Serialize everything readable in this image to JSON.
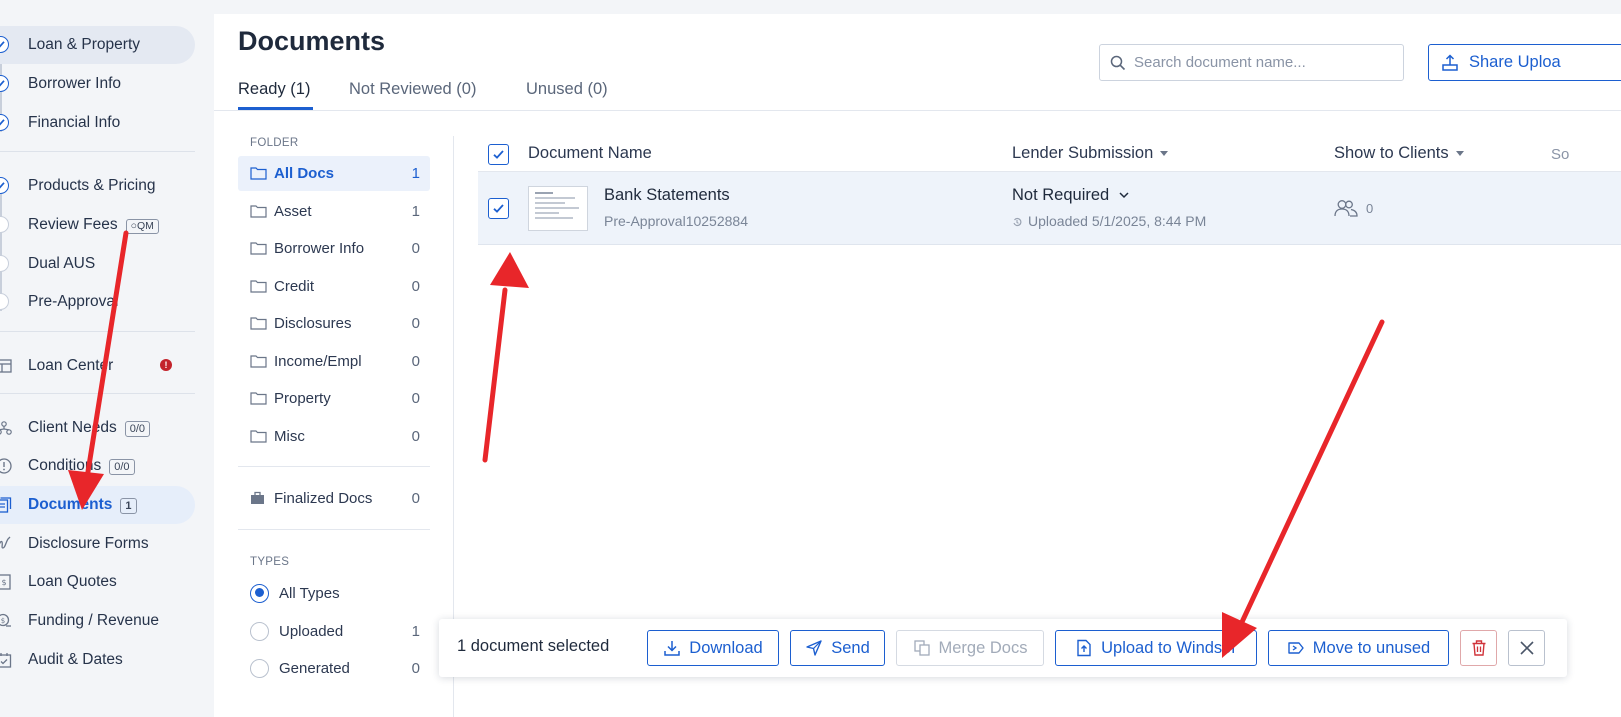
{
  "sidebar": {
    "items": [
      {
        "label": "Loan & Property",
        "state": "done",
        "active": true
      },
      {
        "label": "Borrower Info",
        "state": "done"
      },
      {
        "label": "Financial Info",
        "state": "done"
      },
      {
        "label": "Products & Pricing",
        "state": "done"
      },
      {
        "label": "Review Fees",
        "state": "todo",
        "tag": "QM"
      },
      {
        "label": "Dual AUS",
        "state": "todo"
      },
      {
        "label": "Pre-Approval",
        "state": "todo"
      },
      {
        "label": "Loan Center",
        "alert": "!"
      },
      {
        "label": "Client Needs",
        "badge": "0/0"
      },
      {
        "label": "Conditions",
        "badge": "0/0"
      },
      {
        "label": "Documents",
        "badge": "1",
        "selected": true
      },
      {
        "label": "Disclosure Forms"
      },
      {
        "label": "Loan Quotes"
      },
      {
        "label": "Funding / Revenue"
      },
      {
        "label": "Audit & Dates"
      }
    ]
  },
  "header": {
    "title": "Documents",
    "search_placeholder": "Search document name...",
    "share_label": "Share Uploa"
  },
  "tabs": [
    {
      "label": "Ready (1)",
      "active": true
    },
    {
      "label": "Not Reviewed (0)"
    },
    {
      "label": "Unused (0)"
    }
  ],
  "folders": {
    "section_label": "FOLDER",
    "items": [
      {
        "name": "All Docs",
        "count": "1",
        "selected": true
      },
      {
        "name": "Asset",
        "count": "1"
      },
      {
        "name": "Borrower Info",
        "count": "0"
      },
      {
        "name": "Credit",
        "count": "0"
      },
      {
        "name": "Disclosures",
        "count": "0"
      },
      {
        "name": "Income/Empl",
        "count": "0"
      },
      {
        "name": "Property",
        "count": "0"
      },
      {
        "name": "Misc",
        "count": "0"
      }
    ],
    "finalized": {
      "name": "Finalized Docs",
      "count": "0"
    }
  },
  "types": {
    "section_label": "TYPES",
    "items": [
      {
        "name": "All Types",
        "count": "",
        "selected": true
      },
      {
        "name": "Uploaded",
        "count": "1"
      },
      {
        "name": "Generated",
        "count": "0"
      }
    ]
  },
  "table": {
    "headers": {
      "name": "Document Name",
      "lender": "Lender Submission",
      "clients": "Show to Clients",
      "extra": "So"
    },
    "rows": [
      {
        "name": "Bank Statements",
        "sub": "Pre-Approval10252884",
        "lender_status": "Not Required",
        "uploaded": "Uploaded 5/1/2025, 8:44 PM",
        "clients_count": "0",
        "checked": true
      }
    ]
  },
  "actionbar": {
    "selected_text": "1 document selected",
    "download": "Download",
    "send": "Send",
    "merge": "Merge Docs",
    "upload": "Upload to Windsor",
    "move": "Move to unused"
  },
  "colors": {
    "accent": "#1c5fd0",
    "annotation": "#e8262a"
  }
}
